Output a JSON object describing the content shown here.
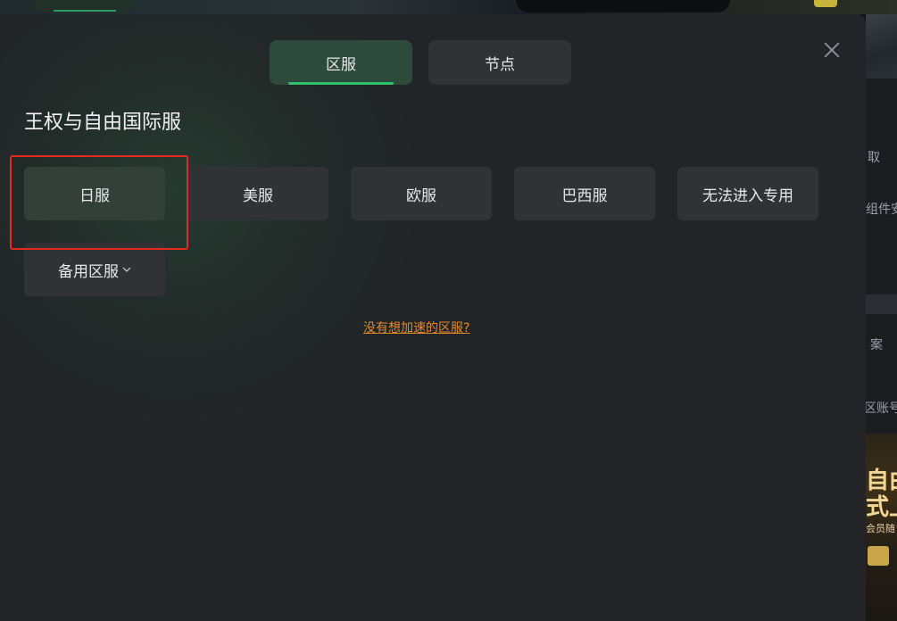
{
  "modal": {
    "tabs": [
      {
        "label": "区服",
        "active": true
      },
      {
        "label": "节点",
        "active": false
      }
    ],
    "game_title": "王权与自由国际服",
    "servers": [
      {
        "label": "日服",
        "highlighted": true
      },
      {
        "label": "美服"
      },
      {
        "label": "欧服"
      },
      {
        "label": "巴西服"
      },
      {
        "label": "无法进入专用"
      },
      {
        "label": "备用区服",
        "has_dropdown": true
      }
    ],
    "help_link": "没有想加速的区服?",
    "close_icon": "close-icon"
  },
  "background": {
    "right_texts": [
      "取",
      "组件安",
      "案",
      "区账号"
    ],
    "banner_text_1": "自由",
    "banner_text_2": "式上",
    "banner_small": "会员随"
  },
  "colors": {
    "accent_green": "#2fc06c",
    "highlight_red": "#e52a22",
    "link_orange": "#e08a2a",
    "modal_bg": "#222427"
  }
}
